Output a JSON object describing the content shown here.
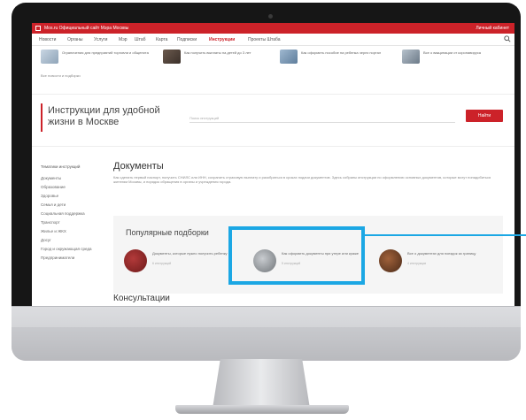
{
  "topbar": {
    "portal_text": "Mos.ru  Официальный сайт Мэра Москвы",
    "login_text": "Личный кабинет"
  },
  "nav": {
    "items": [
      "Новости",
      "Органы",
      "Услуги",
      "Мэр",
      "Штаб",
      "Карта",
      "Подписки",
      "Инструкции",
      "Проекты Штаба"
    ],
    "active_index": 7
  },
  "news": {
    "cards": [
      {
        "text": "Ограничения для предприятий торговли и общепита"
      },
      {
        "text": "Как получить выплаты на детей до 3 лет"
      },
      {
        "text": "Как оформить пособие на ребенка через портал"
      },
      {
        "text": "Все о вакцинации от коронавируса"
      }
    ],
    "all_link": "Все новости и подборки"
  },
  "hero": {
    "title": "Инструкции для удобной жизни в Москве",
    "search_placeholder": "Поиск инструкций",
    "button_label": "Найти"
  },
  "sidebar": {
    "heading": "Тематики инструкций",
    "items": [
      "Документы",
      "Образование",
      "Здоровье",
      "Семья и дети",
      "Социальная поддержка",
      "Транспорт",
      "Жилье и ЖКХ",
      "Досуг",
      "Город и окружающая среда",
      "Предприниматели"
    ]
  },
  "documents": {
    "title": "Документы",
    "description": "Как сделать первый паспорт, получить СНИЛС или ИНН, сохранить страховую выплату и разобраться в сроках подачи документов. Здесь собраны инструкции по оформлению основных документов, которые могут понадобиться жителям Москвы, и порядок обращения в органы и учреждения города."
  },
  "popular": {
    "title": "Популярные подборки",
    "cards": [
      {
        "text": "Документы, которые нужно получить ребенку",
        "sub": "6 инструкций"
      },
      {
        "text": "Как оформить документы при утере или краже",
        "sub": "5 инструкций"
      },
      {
        "text": "Все о документах для поездок за границу",
        "sub": "4 инструкции"
      }
    ]
  },
  "consult": {
    "title": "Консультации"
  },
  "colors": {
    "accent": "#cc2229",
    "highlight": "#1ba7e4"
  }
}
